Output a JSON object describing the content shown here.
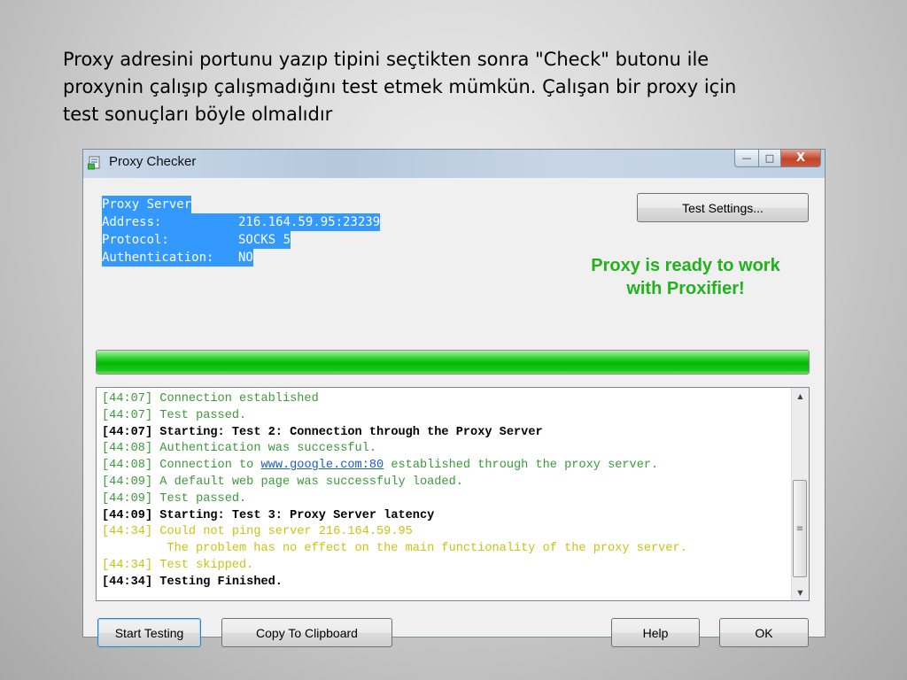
{
  "slide": {
    "caption_lines": [
      "Proxy adresini portunu yazıp tipini seçtikten sonra \"Check\" butonu ile",
      "proxynin çalışıp çalışmadığını test etmek mümkün. Çalışan bir proxy için",
      "test sonuçları böyle olmalıdır"
    ]
  },
  "window": {
    "title": "Proxy Checker",
    "minimize_glyph": "—",
    "maximize_glyph": "□",
    "close_glyph": "X"
  },
  "proxy_info": {
    "heading": "Proxy Server",
    "address_label": "Address:",
    "address_value": "216.164.59.95:23239",
    "protocol_label": "Protocol:",
    "protocol_value": "SOCKS 5",
    "auth_label": "Authentication:",
    "auth_value": "NO"
  },
  "buttons": {
    "test_settings": "Test Settings...",
    "start_testing": "Start Testing",
    "copy_clipboard": "Copy To Clipboard",
    "help": "Help",
    "ok": "OK"
  },
  "status": {
    "line1": "Proxy is ready to work",
    "line2": "with Proxifier!",
    "color": "#22b21e"
  },
  "progress": {
    "fraction": 1.0
  },
  "log": {
    "lines": [
      {
        "time": "[44:07]",
        "text": "Connection established",
        "style": "green"
      },
      {
        "time": "[44:07]",
        "text": "Test passed.",
        "style": "green"
      },
      {
        "time": "[44:07]",
        "text": "Starting: Test 2: Connection through the Proxy Server",
        "style": "black"
      },
      {
        "time": "[44:08]",
        "text": "Authentication was successful.",
        "style": "green"
      },
      {
        "time": "[44:08]",
        "text_pre": "Connection to ",
        "link": "www.google.com:80",
        "text_post": " established through the proxy server.",
        "style": "green"
      },
      {
        "time": "[44:09]",
        "text": "A default web page was successfuly loaded.",
        "style": "green"
      },
      {
        "time": "[44:09]",
        "text": "Test passed.",
        "style": "green"
      },
      {
        "time": "[44:09]",
        "text": "Starting: Test 3: Proxy Server latency",
        "style": "black"
      },
      {
        "time": "[44:34]",
        "text": "Could not ping server 216.164.59.95",
        "style": "yellow"
      },
      {
        "time": "",
        "text": "         The problem has no effect on the main functionality of the proxy server.",
        "style": "yellow"
      },
      {
        "time": "[44:34]",
        "text": "Test skipped.",
        "style": "yellow"
      },
      {
        "time": "[44:34]",
        "text": "Testing Finished.",
        "style": "black"
      }
    ]
  },
  "colors": {
    "selection": "#3399ff",
    "log_green": "#3a9a3a",
    "log_yellow": "#c9c410",
    "progress_green": "#06b406"
  },
  "icons": {
    "app": "proxy-checker-app-icon",
    "scroll_up": "scroll-up-arrow-icon",
    "scroll_down": "scroll-down-arrow-icon"
  }
}
